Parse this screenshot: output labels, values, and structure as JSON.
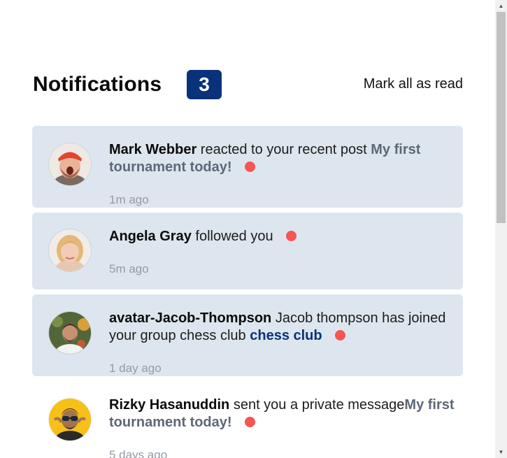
{
  "header": {
    "title": "Notifications",
    "unread_count": "3",
    "mark_all": "Mark all as read"
  },
  "notifications": [
    {
      "name": "Mark Webber",
      "action": " reacted to your recent post ",
      "target": "My first tournament today!",
      "time": "1m ago",
      "unread": true
    },
    {
      "name": "Angela Gray",
      "action": " followed you",
      "target": "",
      "time": "5m ago",
      "unread": true
    },
    {
      "name": "avatar-Jacob-Thompson",
      "action": " Jacob thompson has joined your group chess club ",
      "target": "chess club",
      "time": "1 day ago",
      "unread": true
    },
    {
      "name": "Rizky Hasanuddin",
      "action": " sent you a private message",
      "target": "My first tournament today!",
      "time": "5 days ago",
      "unread": true
    }
  ],
  "colors": {
    "accent": "#0a327a",
    "unread_bg": "#dde6ee",
    "dot": "#f65552",
    "muted": "#939ba6"
  }
}
